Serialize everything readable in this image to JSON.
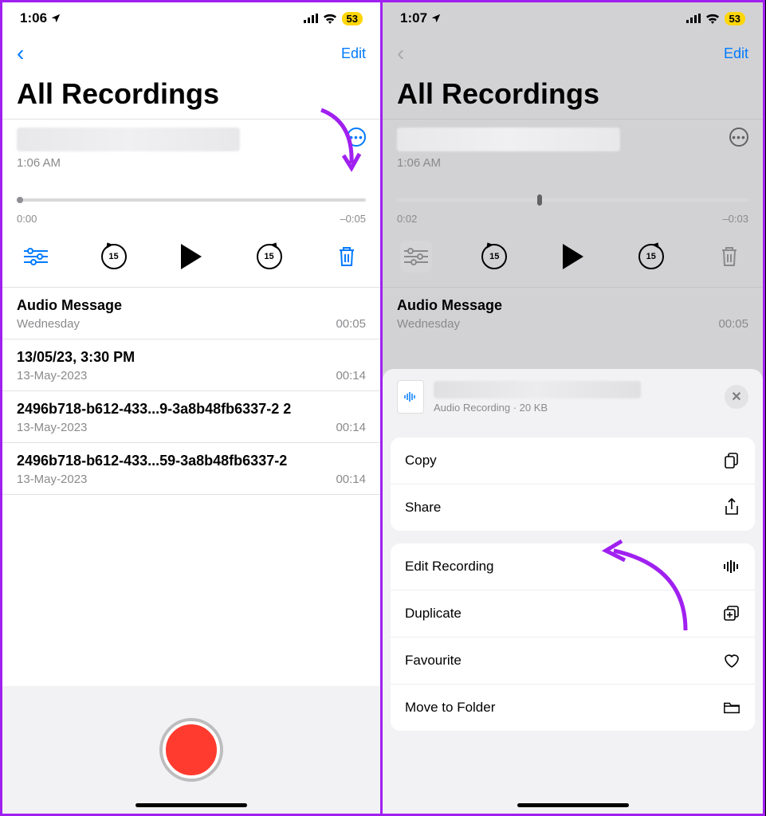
{
  "left": {
    "status": {
      "time": "1:06",
      "battery": "53"
    },
    "nav": {
      "edit": "Edit"
    },
    "title": "All Recordings",
    "active": {
      "timestamp": "1:06 AM",
      "pos": "0:00",
      "remain": "–0:05"
    },
    "skip_label": "15",
    "list": [
      {
        "name": "Audio Message",
        "sub": "Wednesday",
        "dur": "00:05"
      },
      {
        "name": "13/05/23, 3:30 PM",
        "sub": "13-May-2023",
        "dur": "00:14"
      },
      {
        "name": "2496b718-b612-433...9-3a8b48fb6337-2 2",
        "sub": "13-May-2023",
        "dur": "00:14"
      },
      {
        "name": "2496b718-b612-433...59-3a8b48fb6337-2",
        "sub": "13-May-2023",
        "dur": "00:14"
      }
    ]
  },
  "right": {
    "status": {
      "time": "1:07",
      "battery": "53"
    },
    "nav": {
      "edit": "Edit"
    },
    "title": "All Recordings",
    "active": {
      "timestamp": "1:06 AM",
      "pos": "0:02",
      "remain": "–0:03"
    },
    "skip_label": "15",
    "list_first": {
      "name": "Audio Message",
      "sub": "Wednesday",
      "dur": "00:05"
    },
    "sheet": {
      "subtitle": "Audio Recording · 20 KB",
      "items": {
        "copy": "Copy",
        "share": "Share",
        "edit": "Edit Recording",
        "duplicate": "Duplicate",
        "favourite": "Favourite",
        "move": "Move to Folder"
      }
    }
  }
}
